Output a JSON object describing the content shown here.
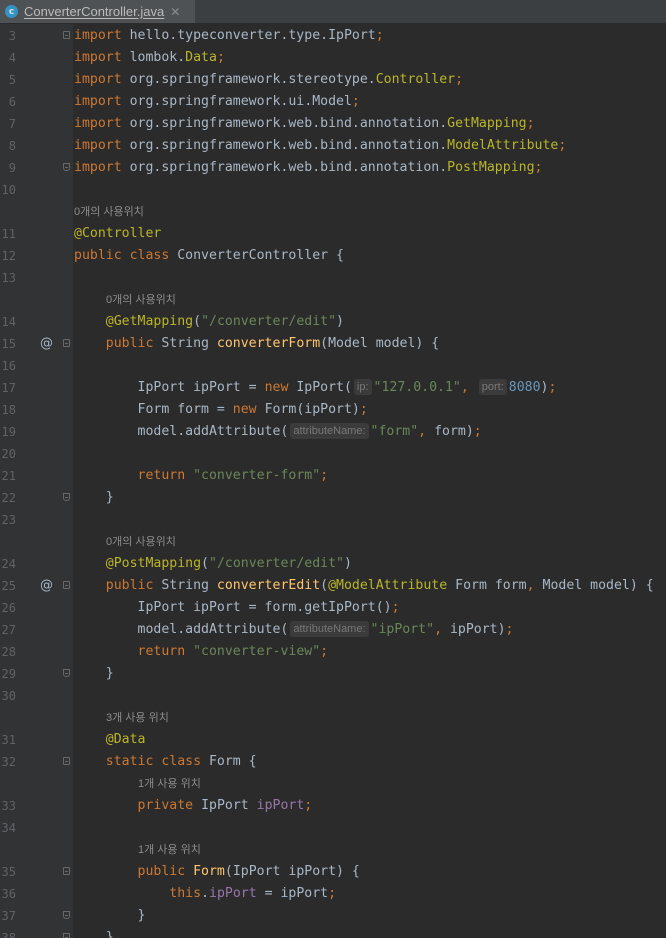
{
  "tab": {
    "file_name": "ConverterController.java",
    "close_glyph": "✕",
    "icon_letter": "c"
  },
  "colors": {
    "background": "#2b2b2b",
    "keyword": "#cc7832",
    "annotation": "#bbb529",
    "string": "#6a8759",
    "number": "#6897bb",
    "field": "#9876aa",
    "method": "#ffc66d",
    "text": "#a9b7c6"
  },
  "lines": [
    {
      "n": "3",
      "fold": "start",
      "tokens": [
        {
          "t": "import",
          "c": "kw"
        },
        {
          "t": " hello.typeconverter.type.IpPort"
        },
        {
          "t": ";",
          "c": "kw"
        }
      ]
    },
    {
      "n": "4",
      "tokens": [
        {
          "t": "import",
          "c": "kw"
        },
        {
          "t": " lombok."
        },
        {
          "t": "Data",
          "c": "ann"
        },
        {
          "t": ";",
          "c": "kw"
        }
      ]
    },
    {
      "n": "5",
      "tokens": [
        {
          "t": "import",
          "c": "kw"
        },
        {
          "t": " org.springframework.stereotype."
        },
        {
          "t": "Controller",
          "c": "ann"
        },
        {
          "t": ";",
          "c": "kw"
        }
      ]
    },
    {
      "n": "6",
      "tokens": [
        {
          "t": "import",
          "c": "kw"
        },
        {
          "t": " org.springframework.ui.Model"
        },
        {
          "t": ";",
          "c": "kw"
        }
      ]
    },
    {
      "n": "7",
      "tokens": [
        {
          "t": "import",
          "c": "kw"
        },
        {
          "t": " org.springframework.web.bind.annotation."
        },
        {
          "t": "GetMapping",
          "c": "ann"
        },
        {
          "t": ";",
          "c": "kw"
        }
      ]
    },
    {
      "n": "8",
      "tokens": [
        {
          "t": "import",
          "c": "kw"
        },
        {
          "t": " org.springframework.web.bind.annotation."
        },
        {
          "t": "ModelAttribute",
          "c": "ann"
        },
        {
          "t": ";",
          "c": "kw"
        }
      ]
    },
    {
      "n": "9",
      "fold": "end",
      "tokens": [
        {
          "t": "import",
          "c": "kw"
        },
        {
          "t": " org.springframework.web.bind.annotation."
        },
        {
          "t": "PostMapping",
          "c": "ann"
        },
        {
          "t": ";",
          "c": "kw"
        }
      ]
    },
    {
      "n": "10",
      "tokens": []
    },
    {
      "hint": "0개의 사용위치",
      "indent": 0
    },
    {
      "n": "11",
      "tokens": [
        {
          "t": "@Controller",
          "c": "ann"
        }
      ]
    },
    {
      "n": "12",
      "tokens": [
        {
          "t": "public class ",
          "c": "kw"
        },
        {
          "t": "ConverterController {"
        }
      ]
    },
    {
      "n": "13",
      "tokens": []
    },
    {
      "hint": "0개의 사용위치",
      "indent": 1
    },
    {
      "n": "14",
      "tokens": [
        {
          "t": "    "
        },
        {
          "t": "@GetMapping",
          "c": "ann"
        },
        {
          "t": "("
        },
        {
          "t": "\"/converter/edit\"",
          "c": "str"
        },
        {
          "t": ")"
        }
      ]
    },
    {
      "n": "15",
      "gutter_mark": "@",
      "fold": "start",
      "tokens": [
        {
          "t": "    "
        },
        {
          "t": "public ",
          "c": "kw"
        },
        {
          "t": "String "
        },
        {
          "t": "converterForm",
          "c": "fn"
        },
        {
          "t": "(Model model) {"
        }
      ]
    },
    {
      "n": "16",
      "tokens": []
    },
    {
      "n": "17",
      "tokens": [
        {
          "t": "        IpPort ipPort = "
        },
        {
          "t": "new ",
          "c": "kw"
        },
        {
          "t": "IpPort("
        },
        {
          "hint": "ip:"
        },
        {
          "t": "\"127.0.0.1\"",
          "c": "str"
        },
        {
          "t": ", ",
          "c": "kw"
        },
        {
          "hint": "port:"
        },
        {
          "t": "8080",
          "c": "num"
        },
        {
          "t": ")"
        },
        {
          "t": ";",
          "c": "kw"
        }
      ]
    },
    {
      "n": "18",
      "tokens": [
        {
          "t": "        Form form = "
        },
        {
          "t": "new ",
          "c": "kw"
        },
        {
          "t": "Form(ipPort)"
        },
        {
          "t": ";",
          "c": "kw"
        }
      ]
    },
    {
      "n": "19",
      "tokens": [
        {
          "t": "        model.addAttribute("
        },
        {
          "hint": "attributeName:"
        },
        {
          "t": "\"form\"",
          "c": "str"
        },
        {
          "t": ", ",
          "c": "kw"
        },
        {
          "t": "form)"
        },
        {
          "t": ";",
          "c": "kw"
        }
      ]
    },
    {
      "n": "20",
      "tokens": []
    },
    {
      "n": "21",
      "tokens": [
        {
          "t": "        "
        },
        {
          "t": "return ",
          "c": "kw"
        },
        {
          "t": "\"converter-form\"",
          "c": "str"
        },
        {
          "t": ";",
          "c": "kw"
        }
      ]
    },
    {
      "n": "22",
      "fold": "end",
      "tokens": [
        {
          "t": "    }"
        }
      ]
    },
    {
      "n": "23",
      "tokens": []
    },
    {
      "hint": "0개의 사용위치",
      "indent": 1
    },
    {
      "n": "24",
      "tokens": [
        {
          "t": "    "
        },
        {
          "t": "@PostMapping",
          "c": "ann"
        },
        {
          "t": "("
        },
        {
          "t": "\"/converter/edit\"",
          "c": "str"
        },
        {
          "t": ")"
        }
      ]
    },
    {
      "n": "25",
      "gutter_mark": "@",
      "fold": "start",
      "tokens": [
        {
          "t": "    "
        },
        {
          "t": "public ",
          "c": "kw"
        },
        {
          "t": "String "
        },
        {
          "t": "converterEdit",
          "c": "fn"
        },
        {
          "t": "("
        },
        {
          "t": "@ModelAttribute ",
          "c": "ann"
        },
        {
          "t": "Form form"
        },
        {
          "t": ", ",
          "c": "kw"
        },
        {
          "t": "Model model) {"
        }
      ]
    },
    {
      "n": "26",
      "tokens": [
        {
          "t": "        IpPort ipPort = form.getIpPort()"
        },
        {
          "t": ";",
          "c": "kw"
        }
      ]
    },
    {
      "n": "27",
      "tokens": [
        {
          "t": "        model.addAttribute("
        },
        {
          "hint": "attributeName:"
        },
        {
          "t": "\"ipPort\"",
          "c": "str"
        },
        {
          "t": ", ",
          "c": "kw"
        },
        {
          "t": "ipPort)"
        },
        {
          "t": ";",
          "c": "kw"
        }
      ]
    },
    {
      "n": "28",
      "tokens": [
        {
          "t": "        "
        },
        {
          "t": "return ",
          "c": "kw"
        },
        {
          "t": "\"converter-view\"",
          "c": "str"
        },
        {
          "t": ";",
          "c": "kw"
        }
      ]
    },
    {
      "n": "29",
      "fold": "end",
      "tokens": [
        {
          "t": "    }"
        }
      ]
    },
    {
      "n": "30",
      "tokens": []
    },
    {
      "hint": "3개 사용 위치",
      "indent": 1
    },
    {
      "n": "31",
      "tokens": [
        {
          "t": "    "
        },
        {
          "t": "@Data",
          "c": "ann"
        }
      ]
    },
    {
      "n": "32",
      "fold": "start",
      "tokens": [
        {
          "t": "    "
        },
        {
          "t": "static class ",
          "c": "kw"
        },
        {
          "t": "Form {"
        }
      ]
    },
    {
      "hint": "1개 사용 위치",
      "indent": 2
    },
    {
      "n": "33",
      "tokens": [
        {
          "t": "        "
        },
        {
          "t": "private ",
          "c": "kw"
        },
        {
          "t": "IpPort "
        },
        {
          "t": "ipPort",
          "c": "fld"
        },
        {
          "t": ";",
          "c": "kw"
        }
      ]
    },
    {
      "n": "34",
      "tokens": []
    },
    {
      "hint": "1개 사용 위치",
      "indent": 2
    },
    {
      "n": "35",
      "fold": "start",
      "tokens": [
        {
          "t": "        "
        },
        {
          "t": "public ",
          "c": "kw"
        },
        {
          "t": "Form",
          "c": "fn"
        },
        {
          "t": "(IpPort ipPort) {"
        }
      ]
    },
    {
      "n": "36",
      "tokens": [
        {
          "t": "            "
        },
        {
          "t": "this",
          "c": "kw"
        },
        {
          "t": "."
        },
        {
          "t": "ipPort",
          "c": "fld"
        },
        {
          "t": " = ipPort"
        },
        {
          "t": ";",
          "c": "kw"
        }
      ]
    },
    {
      "n": "37",
      "fold": "end",
      "tokens": [
        {
          "t": "        }"
        }
      ]
    },
    {
      "n": "38",
      "fold": "end",
      "tokens": [
        {
          "t": "    }"
        }
      ]
    }
  ]
}
